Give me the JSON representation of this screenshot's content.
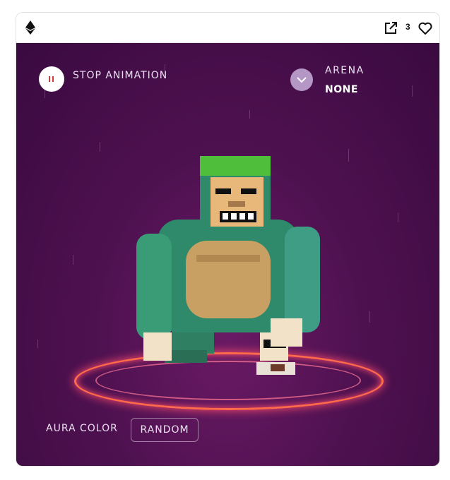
{
  "header": {
    "currency_icon": "ethereum-icon",
    "external_icon": "external-link-icon",
    "like_count": "3",
    "heart_icon": "heart-icon"
  },
  "controls": {
    "stop_animation_label": "STOP ANIMATION",
    "arena_label": "ARENA",
    "arena_value": "NONE",
    "aura_color_label": "AURA COLOR",
    "aura_color_value": "RANDOM"
  },
  "colors": {
    "stage_background": "#4e1150",
    "ring": "#ff5a4f",
    "fur": "#2e8a6a",
    "face": "#e8b87a",
    "hair": "#4fbe3b"
  }
}
